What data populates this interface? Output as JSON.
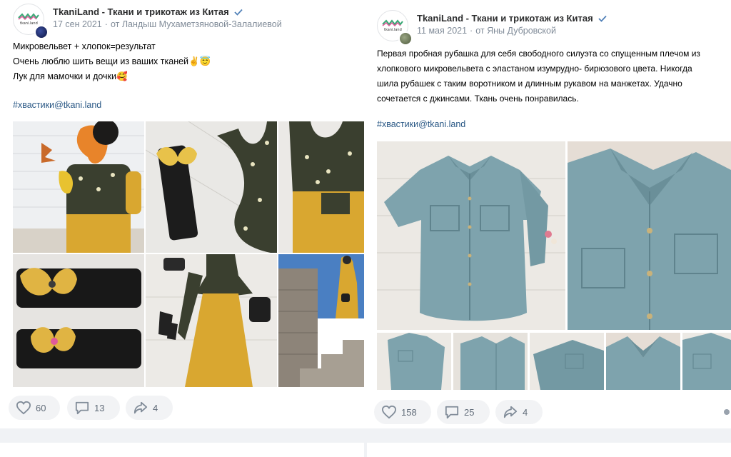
{
  "posts": [
    {
      "group_name": "TkaniLand - Ткани и трикотаж из Китая",
      "date": "17 сен 2021",
      "separator": "·",
      "author": "от Ландыш Мухаметзяновой-Залалиевой",
      "text_lines": [
        "Микровельвет + хлопок=результат",
        "Очень люблю шить вещи из ваших тканей✌😇",
        "Лук для мамочки и дочки🥰"
      ],
      "hashtag": "#хвастики@tkani.land",
      "likes": "60",
      "comments": "13",
      "shares": "4",
      "avatar_logo_text": "tkani.land",
      "avatar_badge_color": "#1a2a6c",
      "photo_subjects": [
        "girl in mustard dress with autumn leaf",
        "black headband with yellow bow and floral top",
        "floral bodice with mustard skirt",
        "headbands with yellow bows",
        "floral top mustard dress with bag and shoes",
        "woman in mustard dress on stone steps"
      ]
    },
    {
      "group_name": "TkaniLand - Ткани и трикотаж из Китая",
      "date": "11 мая 2021",
      "separator": "·",
      "author": "от Яны Дубровской",
      "text_lines": [
        "Первая пробная рубашка для себя свободного силуэта со спущенным плечом из",
        "хлопкового микровельвета с эластаном изумрудно- бирюзового цвета. Никогда",
        "шила рубашек с таким воротником и длинным рукавом на манжетах. Удачно",
        "сочетается с джинсами. Ткань очень понравилась."
      ],
      "hashtag": "#хвастики@tkani.land",
      "likes": "158",
      "comments": "25",
      "shares": "4",
      "avatar_logo_text": "tkani.land",
      "avatar_badge_color": "#6b7b5a",
      "photo_subjects": [
        "turquoise corduroy shirt flat lay",
        "shirt collar close-up",
        "shirt thumbnail 1",
        "shirt thumbnail 2",
        "shirt thumbnail 3",
        "shirt thumbnail 4",
        "shirt thumbnail 5"
      ]
    }
  ],
  "colors": {
    "link": "#2a5885",
    "meta": "#818c99",
    "verified": "#5181b8",
    "action_bg": "#f2f3f5",
    "action_icon": "#818c99",
    "mustard": "#d9a730",
    "shirt": "#7ea3ad"
  },
  "icons": [
    "heart-icon",
    "comment-icon",
    "share-icon",
    "verified-icon",
    "more-icon"
  ]
}
